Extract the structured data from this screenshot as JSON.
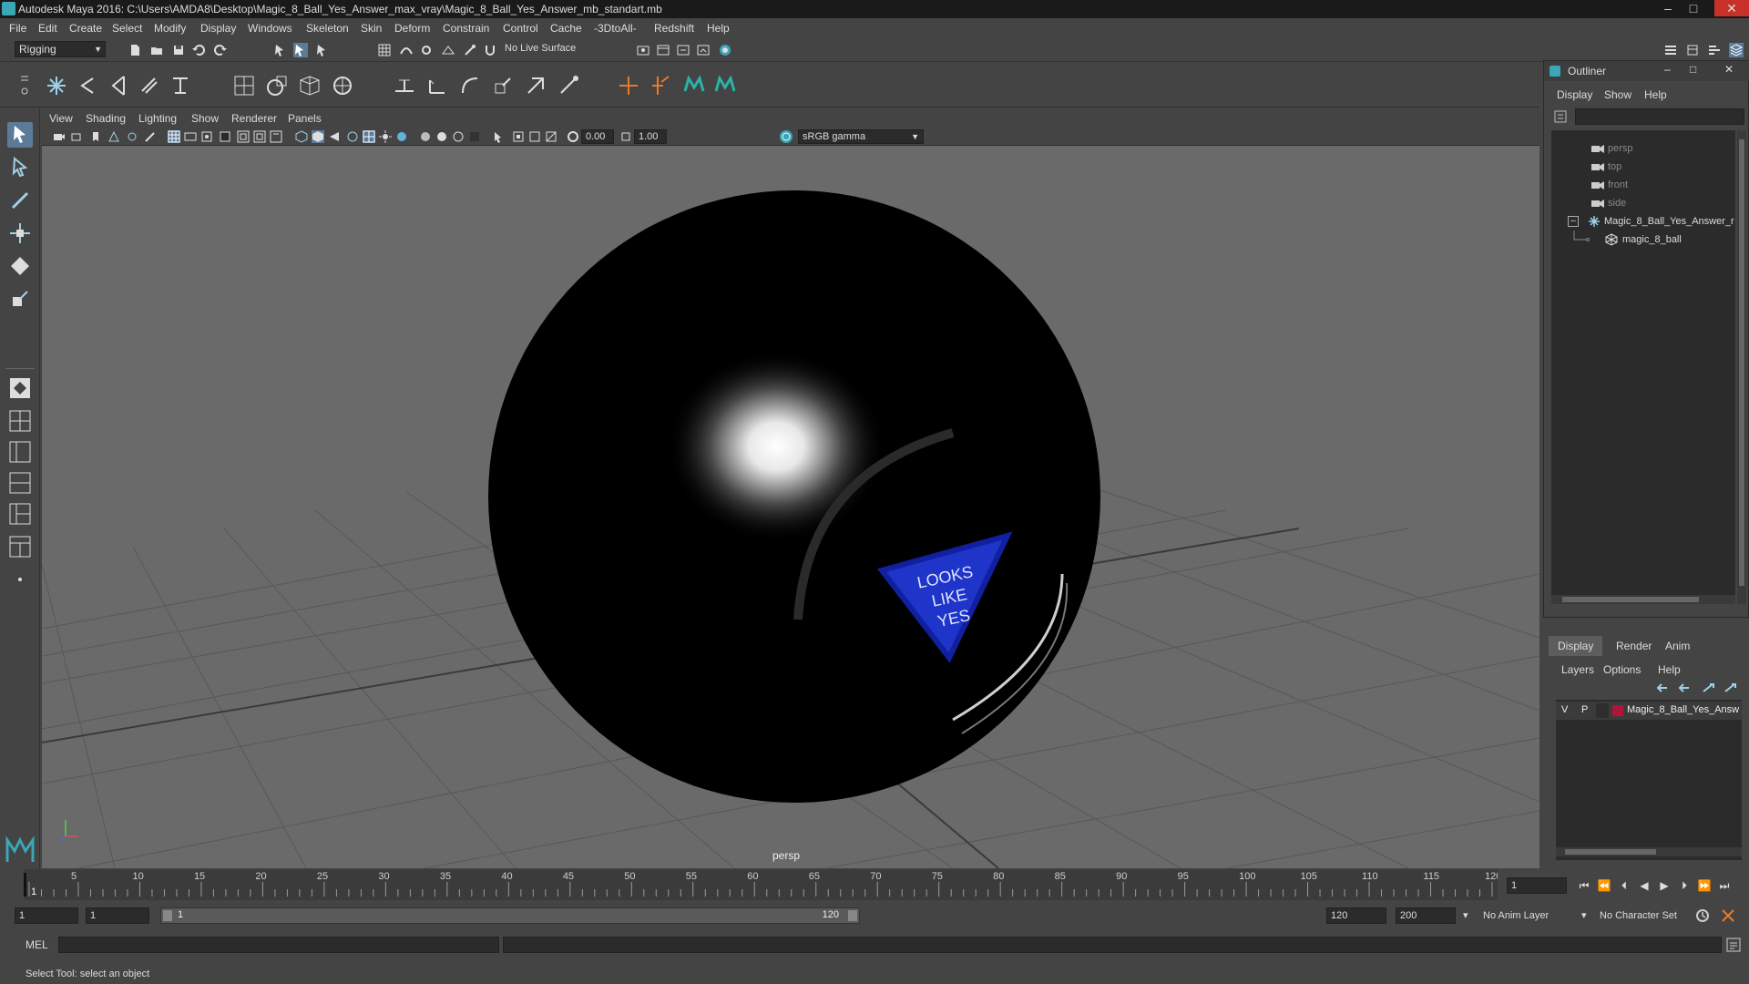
{
  "window": {
    "title": "Autodesk Maya 2016: C:\\Users\\AMDA8\\Desktop\\Magic_8_Ball_Yes_Answer_max_vray\\Magic_8_Ball_Yes_Answer_mb_standart.mb",
    "minimize": "–",
    "maximize": "□",
    "close": "✕"
  },
  "menubar": {
    "items": [
      "File",
      "Edit",
      "Create",
      "Select",
      "Modify",
      "Display",
      "Windows",
      "Skeleton",
      "Skin",
      "Deform",
      "Constrain",
      "Control",
      "Cache",
      "-3DtoAll-",
      "Redshift",
      "Help"
    ]
  },
  "statusline": {
    "mode": "Rigging",
    "live_surface": "No Live Surface"
  },
  "panel": {
    "menus": [
      "View",
      "Shading",
      "Lighting",
      "Show",
      "Renderer",
      "Panels"
    ],
    "exposure": "0.00",
    "gamma": "1.00",
    "color_management": "sRGB gamma",
    "camera_label": "persp"
  },
  "scene": {
    "ball_text": [
      "LOOKS",
      "LIKE",
      "YES"
    ]
  },
  "outliner": {
    "title": "Outliner",
    "menus": [
      "Display",
      "Show",
      "Help"
    ],
    "items": [
      {
        "label": "persp",
        "dim": true
      },
      {
        "label": "top",
        "dim": true
      },
      {
        "label": "front",
        "dim": true
      },
      {
        "label": "side",
        "dim": true
      },
      {
        "label": "Magic_8_Ball_Yes_Answer_r",
        "dim": false
      },
      {
        "label": "magic_8_ball",
        "dim": false
      }
    ],
    "collapse_symbol": "–"
  },
  "layer_editor": {
    "tabs": [
      "Display",
      "Render",
      "Anim"
    ],
    "menus": [
      "Layers",
      "Options",
      "Help"
    ],
    "layer": {
      "visible": "V",
      "playback": "P",
      "name": "Magic_8_Ball_Yes_Answ",
      "color": "#b0143a"
    }
  },
  "timeline": {
    "ticks": [
      "1",
      "5",
      "10",
      "15",
      "20",
      "25",
      "30",
      "35",
      "40",
      "45",
      "50",
      "55",
      "60",
      "65",
      "70",
      "75",
      "80",
      "85",
      "90",
      "95",
      "100",
      "105",
      "110",
      "115",
      "120"
    ],
    "current_frame": "1"
  },
  "range": {
    "start": "1",
    "inner_start": "1",
    "slider_start": "1",
    "slider_end": "120",
    "end": "120",
    "total_end": "200",
    "anim_layer": "No Anim Layer",
    "character_set": "No Character Set"
  },
  "cmdline": {
    "label": "MEL"
  },
  "helpline": {
    "text": "Select Tool: select an object"
  },
  "colors": {
    "viewport_bg": "#6a6a6a",
    "panel_bg": "#444444",
    "accent": "#5c7b99",
    "maya_teal": "#3aa6b6",
    "triangle_blue": "#1f34c8"
  }
}
